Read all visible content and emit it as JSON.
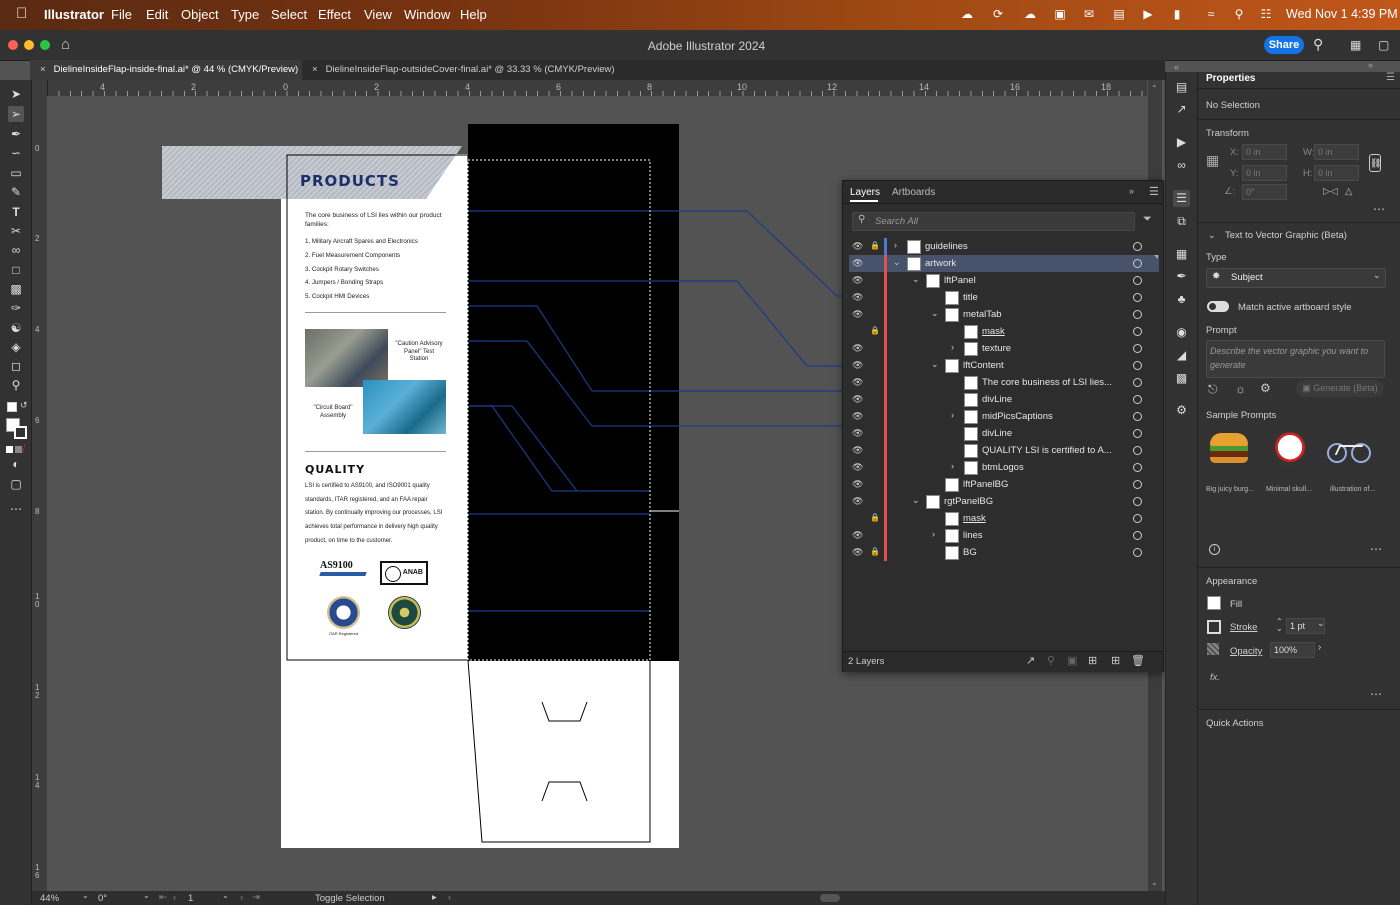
{
  "menubar": {
    "app_name": "Illustrator",
    "items": [
      "File",
      "Edit",
      "Object",
      "Type",
      "Select",
      "Effect",
      "View",
      "Window",
      "Help"
    ],
    "clock": "Wed Nov 1  4:39 PM"
  },
  "window": {
    "title": "Adobe Illustrator 2024",
    "share_label": "Share"
  },
  "tabs": [
    {
      "label": "DielineInsideFlap-inside-final.ai* @ 44 % (CMYK/Preview)"
    },
    {
      "label": "DielineInsideFlap-outsideCover-final.ai* @ 33.33 % (CMYK/Preview)"
    }
  ],
  "ruler": {
    "top_ticks": [
      "4",
      "2",
      "0",
      "2",
      "4",
      "6",
      "8",
      "10",
      "12",
      "14",
      "16",
      "18"
    ],
    "left_ticks": [
      "0",
      "2",
      "4",
      "6",
      "8",
      "1 0",
      "1 2",
      "1 4",
      "1 6"
    ]
  },
  "artboard": {
    "header": "PRODUCTS",
    "intro": "The core business of LSI lies within our product families:",
    "list": [
      "1.  Military Aircraft Spares and Electronics",
      "2.  Fuel Measurement Components",
      "3.  Cockpit Rotary Switches",
      "4.  Jumpers / Bonding Straps",
      "5.  Cockpit HMI Devices"
    ],
    "caption1": "\"Caution Advisory Panel\" Test Station",
    "caption2": "\"Circuit Board\" Assembly",
    "quality_title": "QUALITY",
    "quality_body": "LSI is certified to AS9100, and ISO9001 quality standards, ITAR registered, and an FAA repair station. By continually improving our processes, LSI achieves total performance in delivery high quality product, on time to the customer.",
    "logo_as9100": "AS9100",
    "logo_anab": "ANAB",
    "itar_label": "ITAR Registered"
  },
  "layers_panel": {
    "tab_layers": "Layers",
    "tab_artboards": "Artboards",
    "search_placeholder": "Search All",
    "footer_count": "2 Layers",
    "rows": [
      {
        "name": "guidelines",
        "indent": 0,
        "chevron": "right",
        "locked": true,
        "visible": true,
        "color": "#4a78d8",
        "selected": false,
        "underline": false
      },
      {
        "name": "artwork",
        "indent": 0,
        "chevron": "down",
        "locked": false,
        "visible": true,
        "color": "#e05050",
        "selected": true,
        "underline": false
      },
      {
        "name": "lftPanel",
        "indent": 1,
        "chevron": "down",
        "locked": false,
        "visible": true,
        "color": "#e05050",
        "selected": false,
        "underline": false
      },
      {
        "name": "title",
        "indent": 2,
        "chevron": "",
        "locked": false,
        "visible": true,
        "color": "#e05050",
        "selected": false,
        "underline": false
      },
      {
        "name": "metalTab",
        "indent": 2,
        "chevron": "down",
        "locked": false,
        "visible": true,
        "color": "#e05050",
        "selected": false,
        "underline": false
      },
      {
        "name": "mask",
        "indent": 3,
        "chevron": "",
        "locked": true,
        "visible": false,
        "color": "#e05050",
        "selected": false,
        "underline": true
      },
      {
        "name": "texture",
        "indent": 3,
        "chevron": "right",
        "locked": false,
        "visible": true,
        "color": "#e05050",
        "selected": false,
        "underline": false
      },
      {
        "name": "lftContent",
        "indent": 2,
        "chevron": "down",
        "locked": false,
        "visible": true,
        "color": "#e05050",
        "selected": false,
        "underline": false
      },
      {
        "name": "The core business of LSI lies...",
        "indent": 3,
        "chevron": "",
        "locked": false,
        "visible": true,
        "color": "#e05050",
        "selected": false,
        "underline": false
      },
      {
        "name": "divLine",
        "indent": 3,
        "chevron": "",
        "locked": false,
        "visible": true,
        "color": "#e05050",
        "selected": false,
        "underline": false
      },
      {
        "name": "midPicsCaptions",
        "indent": 3,
        "chevron": "right",
        "locked": false,
        "visible": true,
        "color": "#e05050",
        "selected": false,
        "underline": false
      },
      {
        "name": "divLine",
        "indent": 3,
        "chevron": "",
        "locked": false,
        "visible": true,
        "color": "#e05050",
        "selected": false,
        "underline": false
      },
      {
        "name": "QUALITY LSI is certified to A...",
        "indent": 3,
        "chevron": "",
        "locked": false,
        "visible": true,
        "color": "#e05050",
        "selected": false,
        "underline": false
      },
      {
        "name": "btmLogos",
        "indent": 3,
        "chevron": "right",
        "locked": false,
        "visible": true,
        "color": "#e05050",
        "selected": false,
        "underline": false
      },
      {
        "name": "lftPanelBG",
        "indent": 2,
        "chevron": "",
        "locked": false,
        "visible": true,
        "color": "#e05050",
        "selected": false,
        "underline": false
      },
      {
        "name": "rgtPanelBG",
        "indent": 1,
        "chevron": "down",
        "locked": false,
        "visible": true,
        "color": "#e05050",
        "selected": false,
        "underline": false
      },
      {
        "name": "mask",
        "indent": 2,
        "chevron": "",
        "locked": true,
        "visible": false,
        "color": "#e05050",
        "selected": false,
        "underline": true
      },
      {
        "name": "lines",
        "indent": 2,
        "chevron": "right",
        "locked": false,
        "visible": true,
        "color": "#e05050",
        "selected": false,
        "underline": false
      },
      {
        "name": "BG",
        "indent": 2,
        "chevron": "",
        "locked": true,
        "visible": true,
        "color": "#e05050",
        "selected": false,
        "underline": false
      }
    ]
  },
  "properties": {
    "title": "Properties",
    "selection": "No Selection",
    "transform_label": "Transform",
    "x_label": "X:",
    "y_label": "Y:",
    "w_label": "W:",
    "h_label": "H:",
    "x_value": "0 in",
    "y_value": "0 in",
    "w_value": "0 in",
    "h_value": "0 in",
    "angle_value": "0°",
    "t2v_label": "Text to Vector Graphic (Beta)",
    "type_label": "Type",
    "type_value": "Subject",
    "match_label": "Match active artboard style",
    "prompt_label": "Prompt",
    "prompt_placeholder": "Describe the vector graphic you want to generate",
    "generate_label": "Generate (Beta)",
    "sample_label": "Sample Prompts",
    "samples": [
      "Big juicy burg...",
      "Minimal skull...",
      "illustration of..."
    ],
    "appearance_label": "Appearance",
    "fill_label": "Fill",
    "stroke_label": "Stroke",
    "stroke_value": "1 pt",
    "opacity_label": "Opacity",
    "opacity_value": "100%",
    "fx_label": "fx.",
    "quick_actions_label": "Quick Actions"
  },
  "status": {
    "zoom": "44%",
    "rotation": "0°",
    "artboard_num": "1",
    "toggle_label": "Toggle Selection"
  }
}
